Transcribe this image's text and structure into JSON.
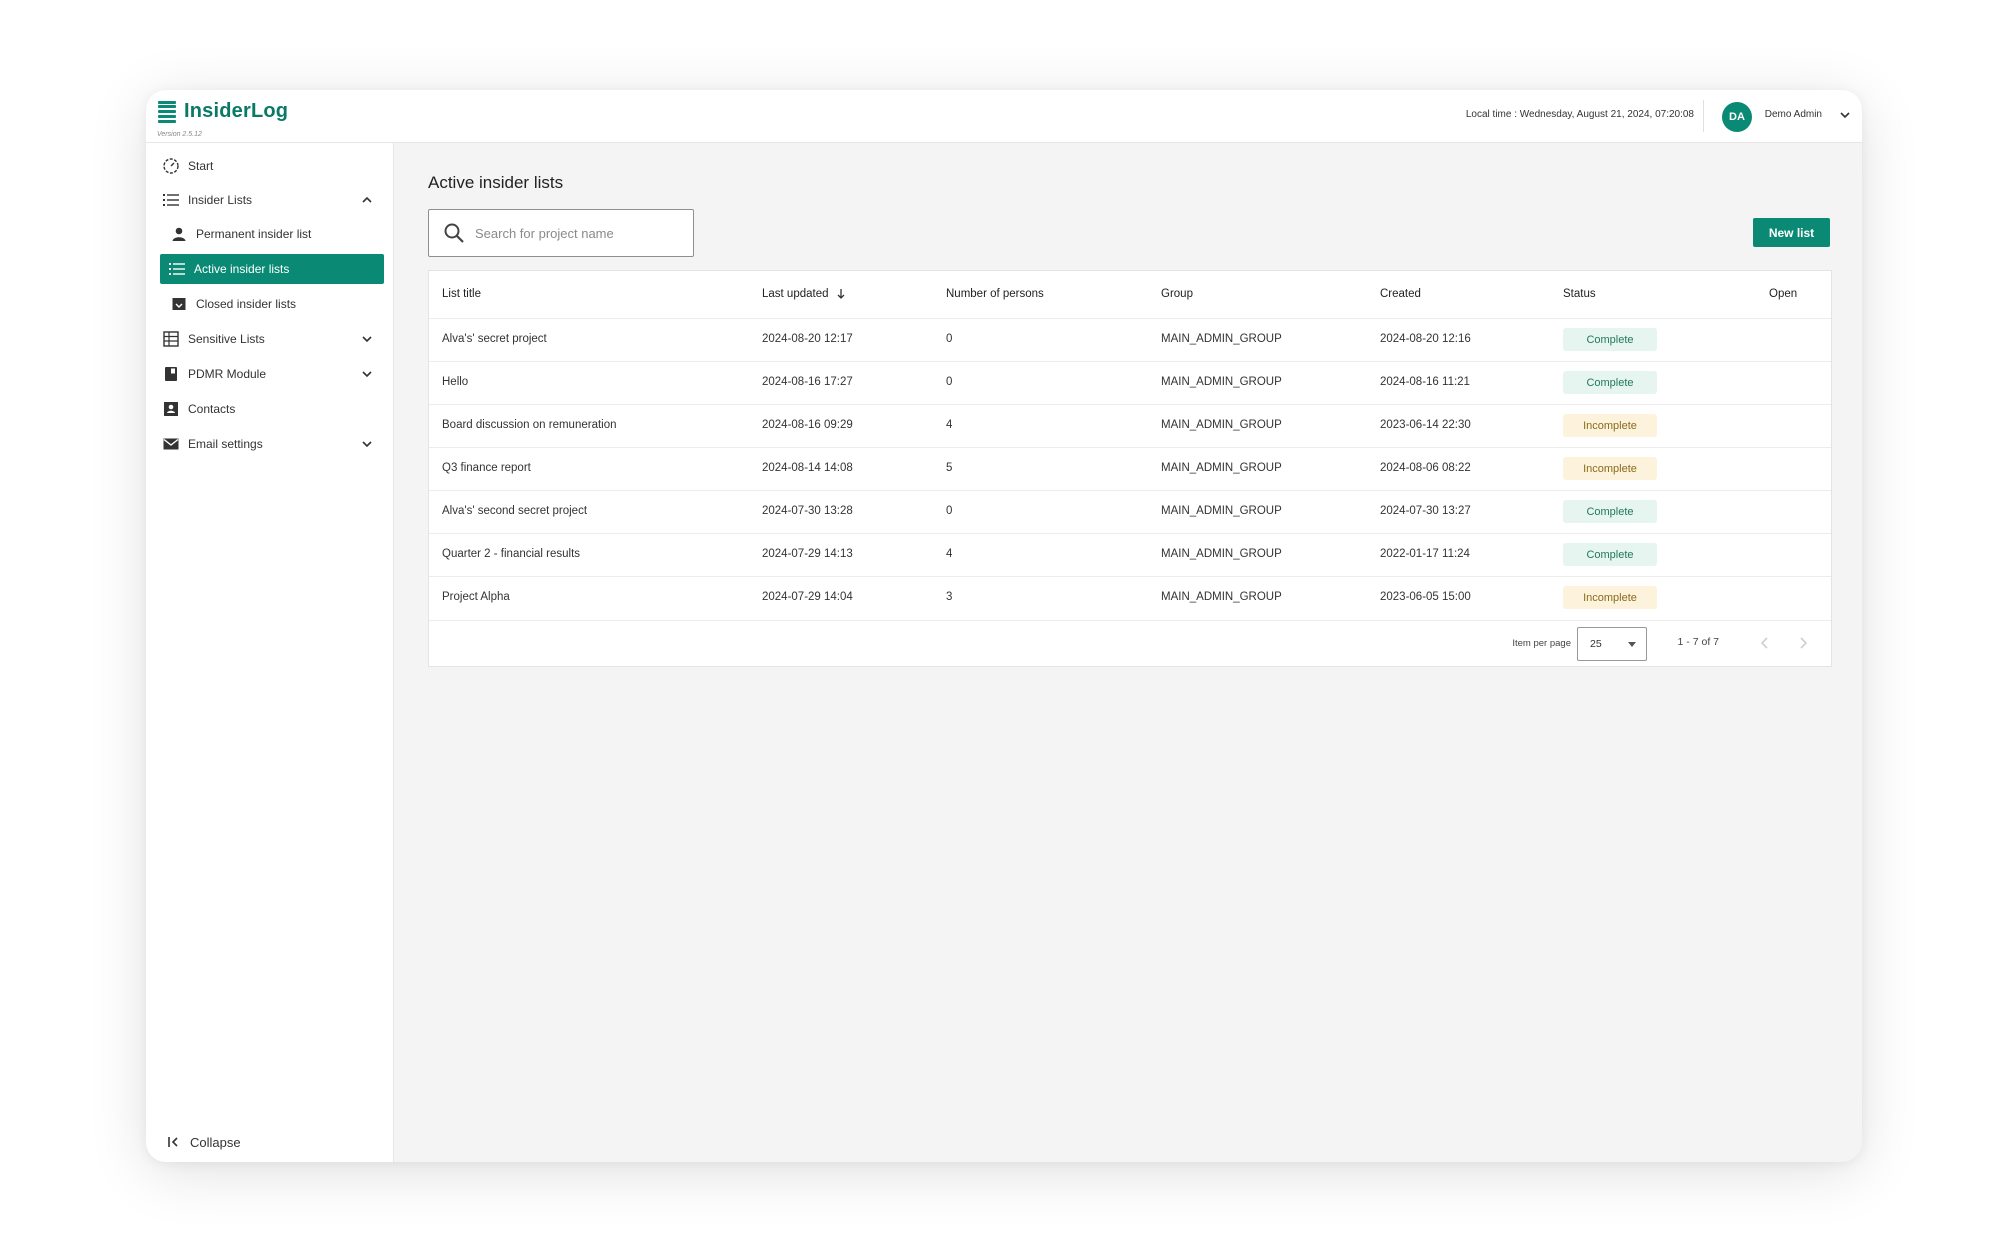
{
  "header": {
    "brand": "InsiderLog",
    "version": "Version 2.5.12",
    "local_time": "Local time : Wednesday, August 21, 2024, 07:20:08",
    "user_initials": "DA",
    "user_name": "Demo Admin"
  },
  "sidebar": {
    "items": [
      {
        "label": "Start",
        "icon": "dashboard-gauge-icon"
      },
      {
        "label": "Insider Lists",
        "icon": "list-icon",
        "expanded": true
      },
      {
        "label": "Permanent insider list",
        "icon": "person-icon"
      },
      {
        "label": "Active insider lists",
        "icon": "list-icon",
        "active": true
      },
      {
        "label": "Closed insider lists",
        "icon": "archive-box-icon"
      },
      {
        "label": "Sensitive Lists",
        "icon": "table-icon",
        "expanded": false
      },
      {
        "label": "PDMR Module",
        "icon": "book-icon",
        "expanded": false
      },
      {
        "label": "Contacts",
        "icon": "contact-card-icon"
      },
      {
        "label": "Email settings",
        "icon": "envelope-icon",
        "expanded": false
      }
    ],
    "collapse_label": "Collapse"
  },
  "main": {
    "title": "Active insider lists",
    "search_placeholder": "Search for project name",
    "new_list_label": "New list",
    "columns": [
      "List title",
      "Last updated",
      "Number of persons",
      "Group",
      "Created",
      "Status",
      "Open"
    ],
    "rows": [
      {
        "title": "Alva's' secret project",
        "updated": "2024-08-20 12:17",
        "persons": "0",
        "group": "MAIN_ADMIN_GROUP",
        "created": "2024-08-20 12:16",
        "status": "Complete"
      },
      {
        "title": "Hello",
        "updated": "2024-08-16 17:27",
        "persons": "0",
        "group": "MAIN_ADMIN_GROUP",
        "created": "2024-08-16 11:21",
        "status": "Complete"
      },
      {
        "title": "Board discussion on remuneration",
        "updated": "2024-08-16 09:29",
        "persons": "4",
        "group": "MAIN_ADMIN_GROUP",
        "created": "2023-06-14 22:30",
        "status": "Incomplete"
      },
      {
        "title": "Q3 finance report",
        "updated": "2024-08-14 14:08",
        "persons": "5",
        "group": "MAIN_ADMIN_GROUP",
        "created": "2024-08-06 08:22",
        "status": "Incomplete"
      },
      {
        "title": "Alva's' second secret project",
        "updated": "2024-07-30 13:28",
        "persons": "0",
        "group": "MAIN_ADMIN_GROUP",
        "created": "2024-07-30 13:27",
        "status": "Complete"
      },
      {
        "title": "Quarter 2 - financial results",
        "updated": "2024-07-29 14:13",
        "persons": "4",
        "group": "MAIN_ADMIN_GROUP",
        "created": "2022-01-17 11:24",
        "status": "Complete"
      },
      {
        "title": "Project Alpha",
        "updated": "2024-07-29 14:04",
        "persons": "3",
        "group": "MAIN_ADMIN_GROUP",
        "created": "2023-06-05 15:00",
        "status": "Incomplete"
      }
    ],
    "pagination": {
      "items_per_page_label": "Item per page",
      "items_per_page": "25",
      "range": "1 - 7 of 7"
    }
  },
  "colors": {
    "brand": "#0a8a74",
    "complete_bg": "#e6f5ef",
    "incomplete_bg": "#fdf3dc"
  }
}
